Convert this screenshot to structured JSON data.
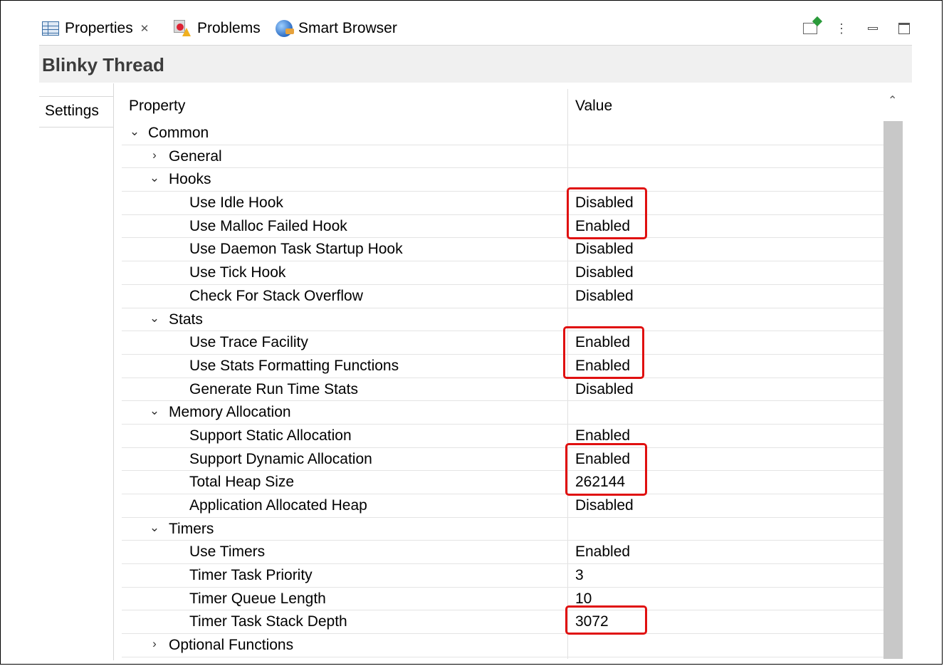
{
  "tabs": [
    {
      "label": "Properties",
      "icon": "properties-icon",
      "closable": true
    },
    {
      "label": "Problems",
      "icon": "problems-icon"
    },
    {
      "label": "Smart Browser",
      "icon": "smart-browser-icon"
    }
  ],
  "title": "Blinky Thread",
  "side_tab": "Settings",
  "columns": {
    "property": "Property",
    "value": "Value"
  },
  "rows": [
    {
      "name": "Common",
      "value": "",
      "level": 0,
      "expander": "expanded"
    },
    {
      "name": "General",
      "value": "",
      "level": 1,
      "expander": "collapsed"
    },
    {
      "name": "Hooks",
      "value": "",
      "level": 1,
      "expander": "expanded"
    },
    {
      "name": "Use Idle Hook",
      "value": "Disabled",
      "level": 2
    },
    {
      "name": "Use Malloc Failed Hook",
      "value": "Enabled",
      "level": 2
    },
    {
      "name": "Use Daemon Task Startup Hook",
      "value": "Disabled",
      "level": 2
    },
    {
      "name": "Use Tick Hook",
      "value": "Disabled",
      "level": 2
    },
    {
      "name": "Check For Stack Overflow",
      "value": "Disabled",
      "level": 2
    },
    {
      "name": "Stats",
      "value": "",
      "level": 1,
      "expander": "expanded"
    },
    {
      "name": "Use Trace Facility",
      "value": "Enabled",
      "level": 2
    },
    {
      "name": "Use Stats Formatting Functions",
      "value": "Enabled",
      "level": 2
    },
    {
      "name": "Generate Run Time Stats",
      "value": "Disabled",
      "level": 2
    },
    {
      "name": "Memory Allocation",
      "value": "",
      "level": 1,
      "expander": "expanded"
    },
    {
      "name": "Support Static Allocation",
      "value": "Enabled",
      "level": 2
    },
    {
      "name": "Support Dynamic Allocation",
      "value": "Enabled",
      "level": 2
    },
    {
      "name": "Total Heap Size",
      "value": "262144",
      "level": 2
    },
    {
      "name": "Application Allocated Heap",
      "value": "Disabled",
      "level": 2
    },
    {
      "name": "Timers",
      "value": "",
      "level": 1,
      "expander": "expanded"
    },
    {
      "name": "Use Timers",
      "value": "Enabled",
      "level": 2
    },
    {
      "name": "Timer Task Priority",
      "value": "3",
      "level": 2
    },
    {
      "name": "Timer Queue Length",
      "value": "10",
      "level": 2
    },
    {
      "name": "Timer Task Stack Depth",
      "value": "3072",
      "level": 2
    },
    {
      "name": "Optional Functions",
      "value": "",
      "level": 1,
      "expander": "collapsed"
    }
  ],
  "highlight_color": "#e01010"
}
